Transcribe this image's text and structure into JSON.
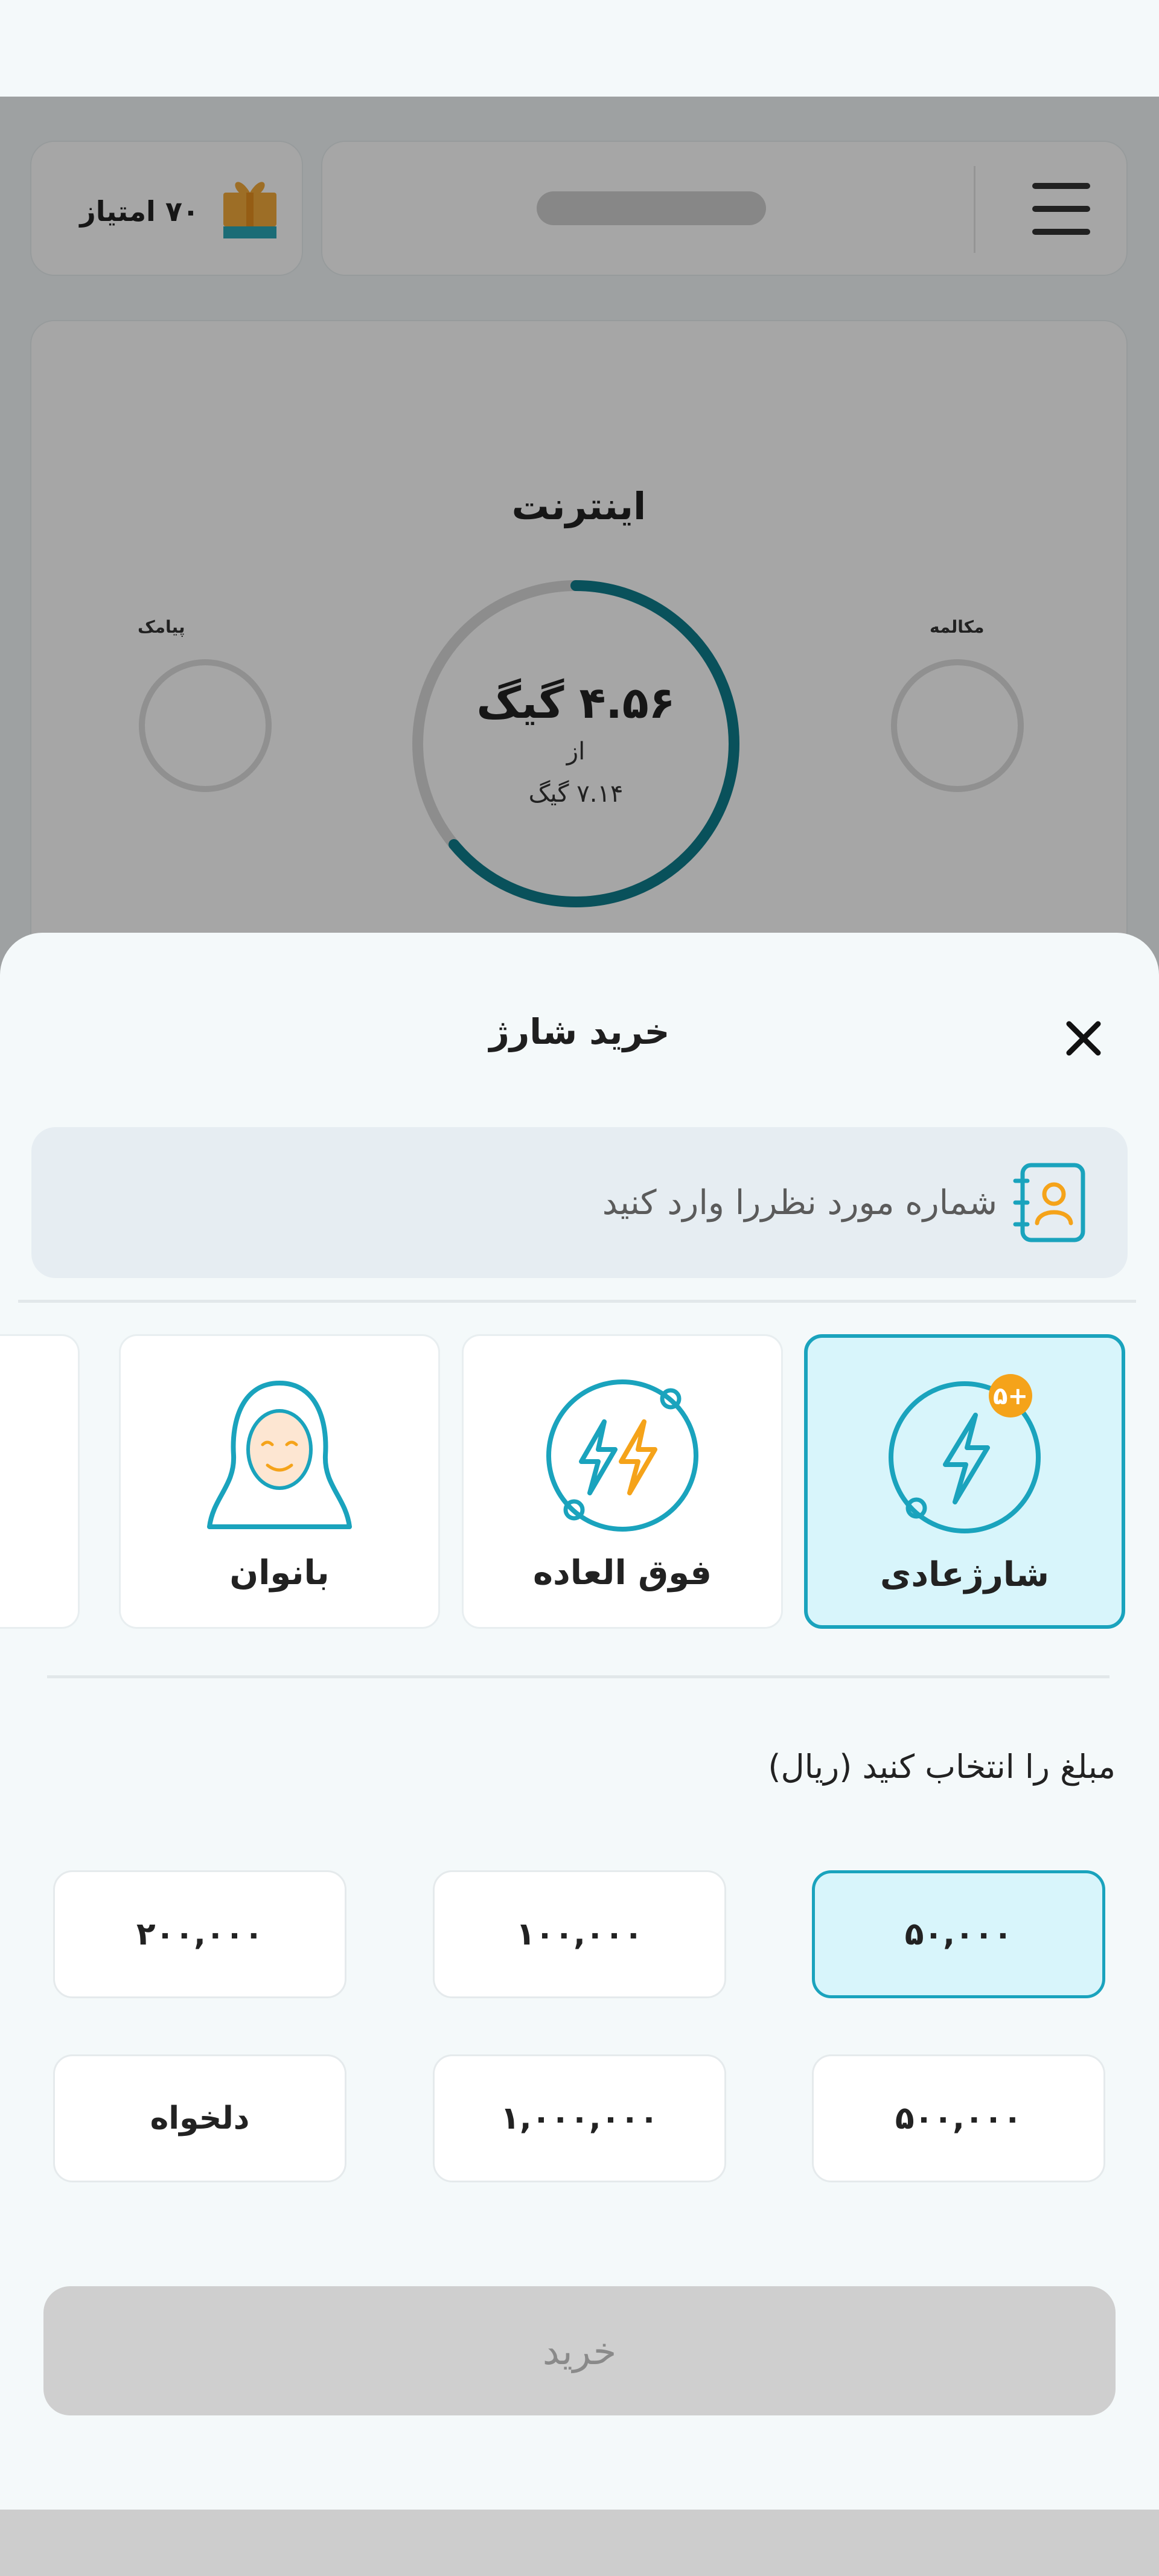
{
  "background": {
    "points_label": "۷۰ امتیاز",
    "usage": {
      "title": "اینترنت",
      "remaining": "۴.۵۶ گیگ",
      "of_label": "از",
      "total": "۷.۱۴ گیگ",
      "remaining_fraction": 0.64,
      "left_mini_label": "پیامک",
      "right_mini_label": "مکالمه"
    }
  },
  "sheet": {
    "title": "خرید شارژ",
    "phone_placeholder": "شماره مورد نظررا وارد کنید",
    "charge_types": [
      {
        "label": "شارژعادی",
        "badge": "+۵",
        "selected": true
      },
      {
        "label": "فوق العاده",
        "selected": false
      },
      {
        "label": "بانوان",
        "selected": false
      }
    ],
    "amount_title": "مبلغ را انتخاب کنید (ریال)",
    "amounts": [
      "۵۰,۰۰۰",
      "۱۰۰,۰۰۰",
      "۲۰۰,۰۰۰",
      "۵۰۰,۰۰۰",
      "۱,۰۰۰,۰۰۰",
      "دلخواه"
    ],
    "selected_amount_index": 0,
    "buy_label": "خرید"
  },
  "colors": {
    "accent": "#1aa3bd",
    "accent_light": "#d8f5fb",
    "gauge": "#0f7d8c",
    "badge": "#f5a31a",
    "disabled": "#cfcfcf"
  }
}
